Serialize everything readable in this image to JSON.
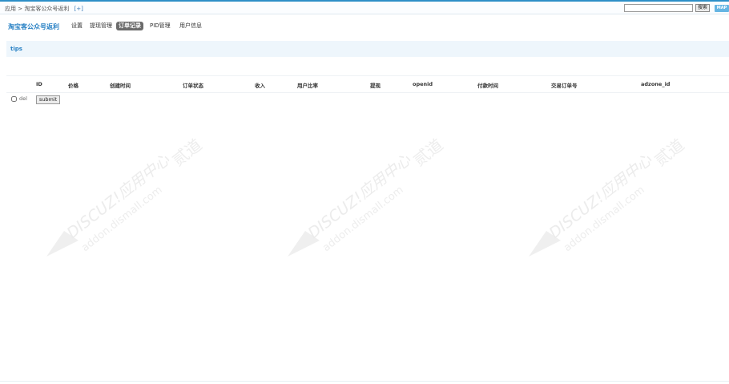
{
  "breadcrumb": {
    "root": "应用",
    "sep": ">",
    "current": "淘宝客公众号返利",
    "add": "[+]"
  },
  "search": {
    "value": "",
    "button_label": "搜索"
  },
  "map_label": "MAP",
  "nav": {
    "title": "淘宝客公众号返利",
    "tabs": [
      {
        "label": "设置"
      },
      {
        "label": "提现管理"
      },
      {
        "label": "订单记录"
      },
      {
        "label": "PID管理"
      },
      {
        "label": "用户信息"
      }
    ],
    "active_tab": "订单记录"
  },
  "tips_label": "tips",
  "table": {
    "columns": [
      "ID",
      "价格",
      "创建时间",
      "订单状态",
      "收入",
      "用户比率",
      "提现",
      "openid",
      "付款时间",
      "交易订单号",
      "adzone_id"
    ],
    "rows": []
  },
  "del_label": "del",
  "submit_label": "submit",
  "watermark": {
    "brand": "DISCUZ!应用中心",
    "domain": "addon.dismall.com",
    "suffix": "贰道"
  }
}
